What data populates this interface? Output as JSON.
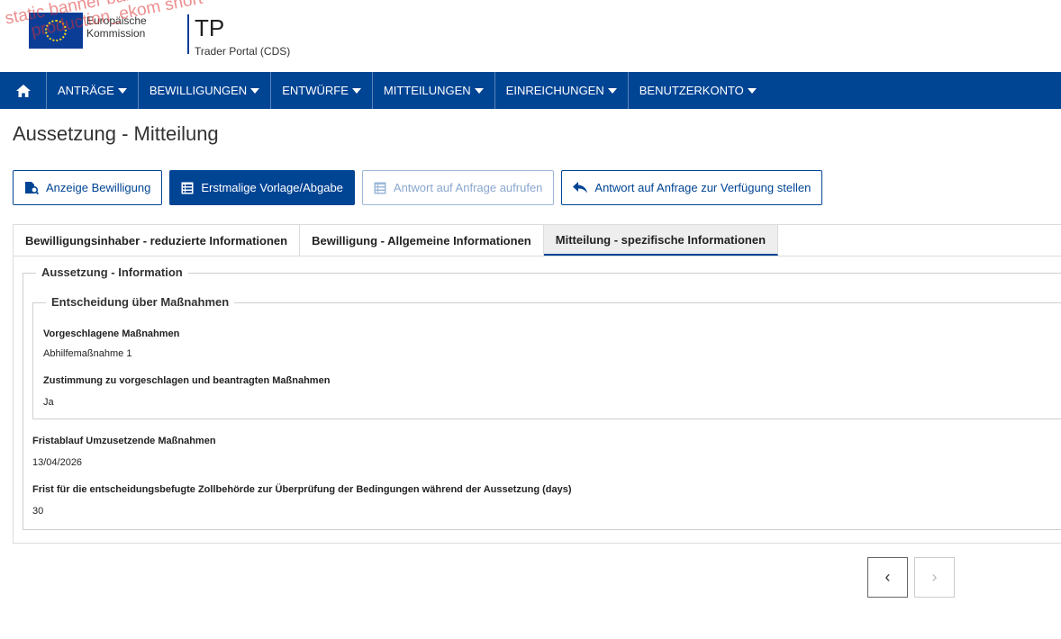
{
  "header": {
    "watermark_line1": "static banner banner_pre-",
    "watermark_line2": "production_ekom short",
    "org_line1": "Europäische",
    "org_line2": "Kommission",
    "app_title": "TP",
    "app_subtitle": "Trader Portal (CDS)"
  },
  "navbar": {
    "items": [
      {
        "label": "ANTRÄGE"
      },
      {
        "label": "BEWILLIGUNGEN"
      },
      {
        "label": "ENTWÜRFE"
      },
      {
        "label": "MITTEILUNGEN"
      },
      {
        "label": "EINREICHUNGEN"
      },
      {
        "label": "BENUTZERKONTO"
      }
    ]
  },
  "page": {
    "title": "Aussetzung - Mitteilung"
  },
  "actions": {
    "show_authorisation": "Anzeige Bewilligung",
    "initial_submission": "Erstmalige Vorlage/Abgabe",
    "view_response": "Antwort auf Anfrage aufrufen",
    "provide_response": "Antwort auf Anfrage zur Verfügung stellen"
  },
  "tabs": [
    {
      "label": "Bewilligungsinhaber - reduzierte Informationen"
    },
    {
      "label": "Bewilligung - Allgemeine Informationen"
    },
    {
      "label": "Mitteilung - spezifische Informationen"
    }
  ],
  "section": {
    "outer_legend": "Aussetzung - Information",
    "inner_legend": "Entscheidung über Maßnahmen",
    "fields": {
      "proposed_measures_label": "Vorgeschlagene Maßnahmen",
      "proposed_measures_value": "Abhilfemaßnahme 1",
      "consent_label": "Zustimmung zu vorgeschlagen und beantragten Maßnahmen",
      "consent_value": "Ja",
      "deadline_label": "Fristablauf Umzusetzende Maßnahmen",
      "deadline_value": "13/04/2026",
      "review_period_label": "Frist für die entscheidungsbefugte Zollbehörde zur Überprüfung der Bedingungen während der Aussetzung (days)",
      "review_period_value": "30"
    }
  },
  "pager": {
    "prev": "‹",
    "next": "›"
  },
  "colors": {
    "brand_blue": "#004494",
    "disabled_blue": "#8aa7cf"
  }
}
